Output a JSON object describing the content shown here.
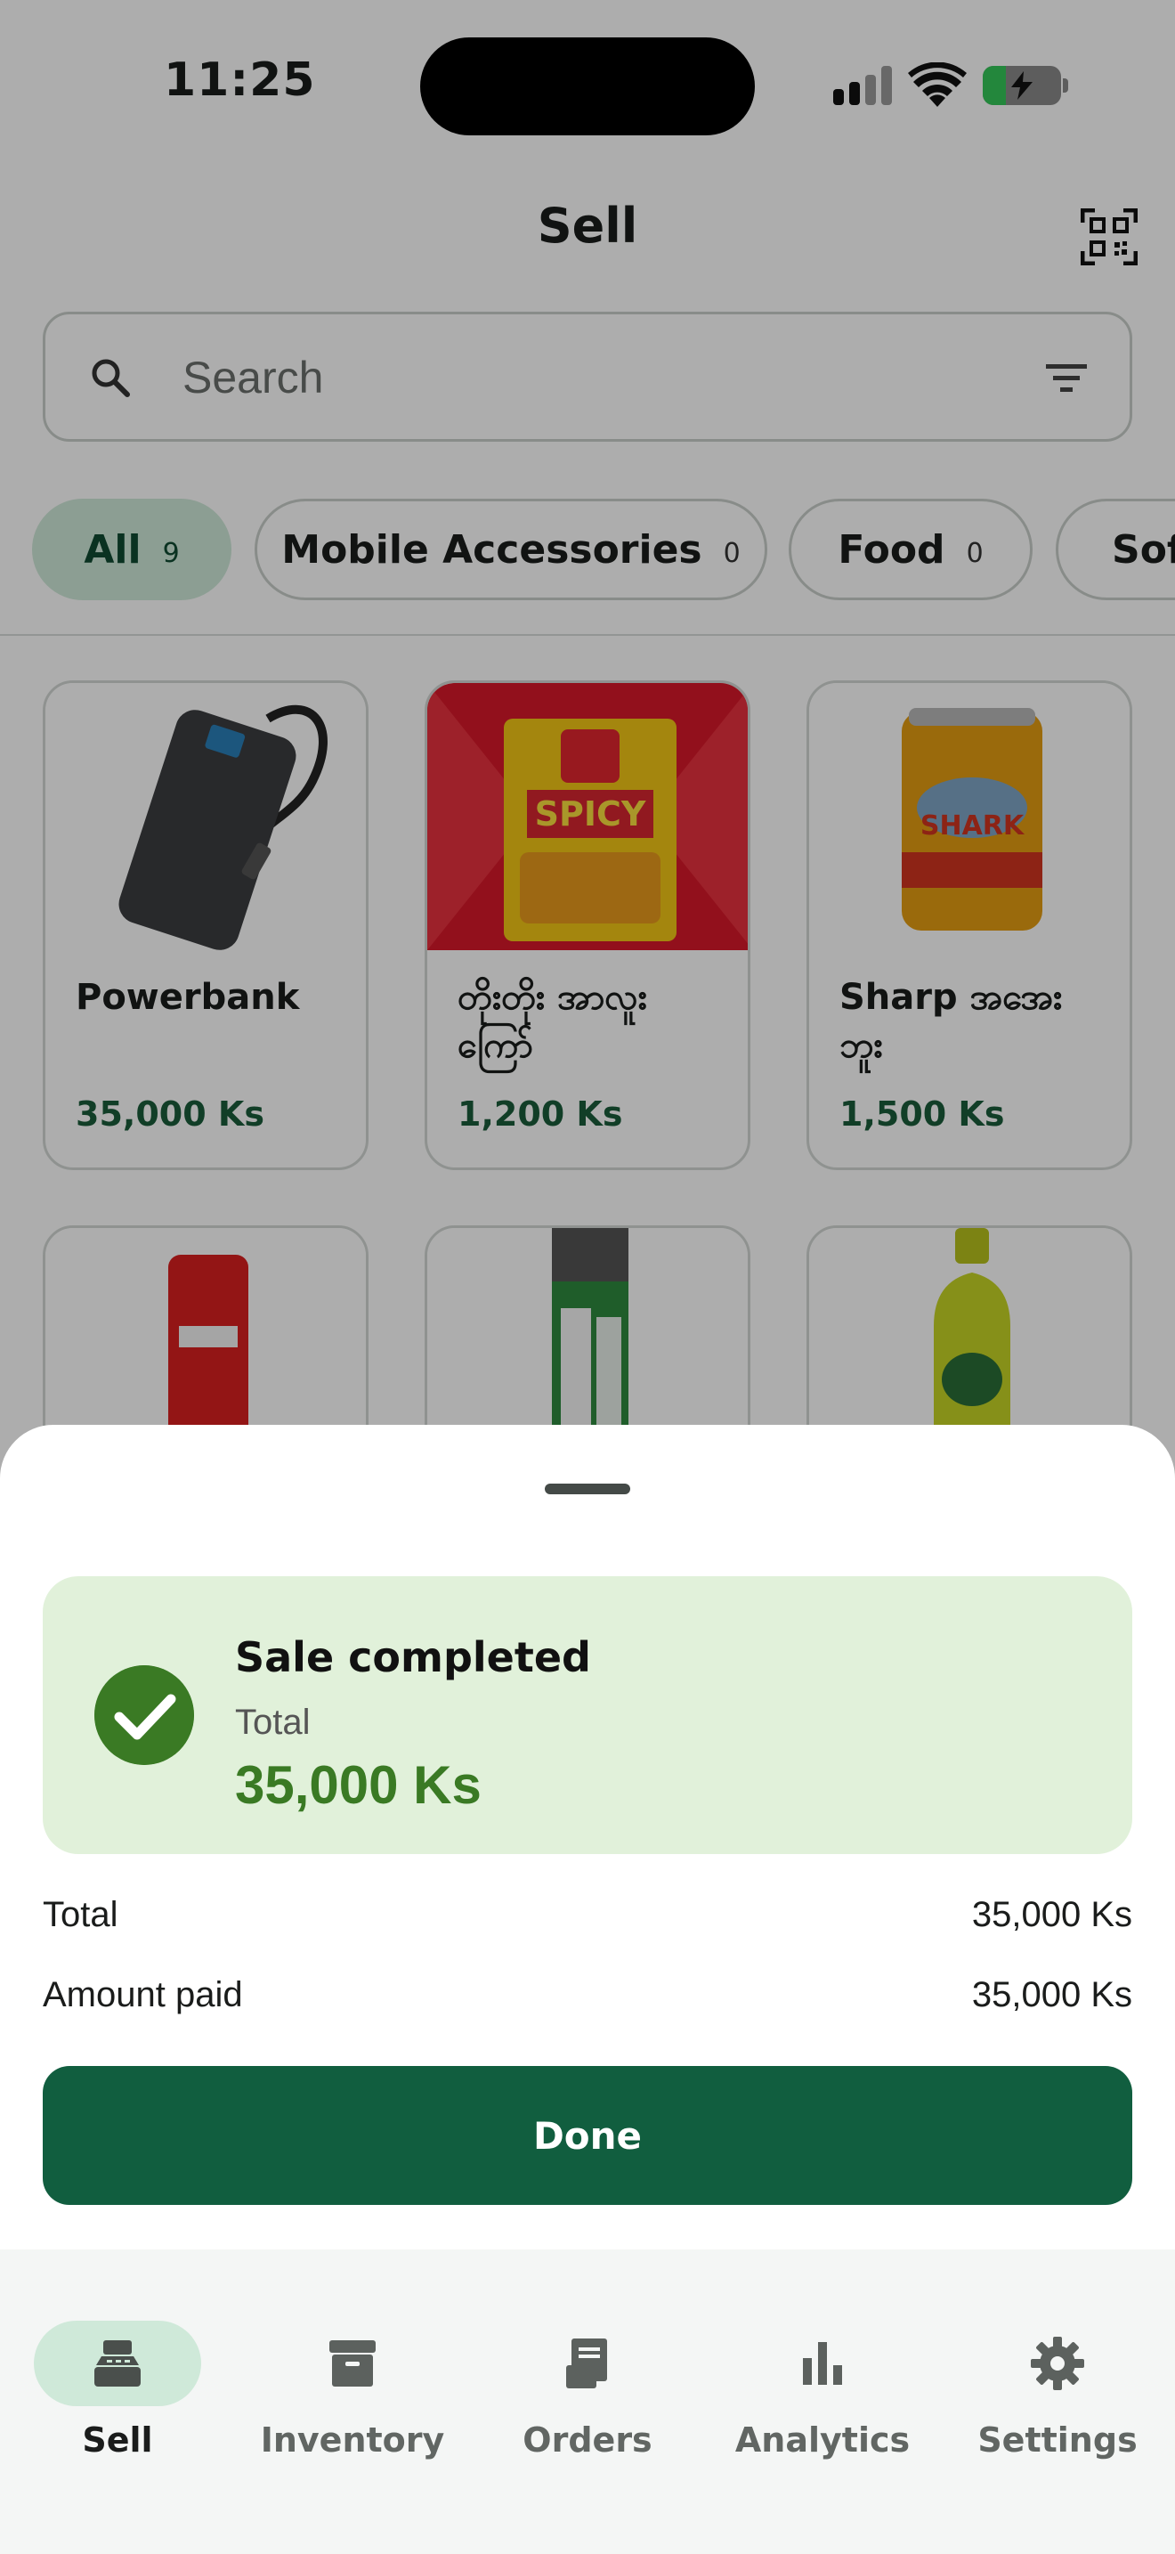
{
  "status_bar": {
    "time": "11:25"
  },
  "header": {
    "title": "Sell",
    "qr_icon": "qr-scan-icon"
  },
  "search": {
    "placeholder": "Search"
  },
  "categories": [
    {
      "label": "All",
      "count": "9",
      "active": true
    },
    {
      "label": "Mobile Accessories",
      "count": "0",
      "active": false
    },
    {
      "label": "Food",
      "count": "0",
      "active": false
    },
    {
      "label": "Soft",
      "count": "",
      "active": false
    }
  ],
  "products": [
    {
      "name": "Powerbank",
      "price": "35,000 Ks"
    },
    {
      "name": "တိုးတိုး အာလူး ကြော်",
      "price": "1,200 Ks"
    },
    {
      "name": "Sharp အအေး ဘူး",
      "price": "1,500 Ks"
    }
  ],
  "sheet": {
    "title": "Sale completed",
    "total_label": "Total",
    "total_amount": "35,000 Ks",
    "rows": [
      {
        "label": "Total",
        "value": "35,000 Ks"
      },
      {
        "label": "Amount paid",
        "value": "35,000 Ks"
      }
    ],
    "done_label": "Done"
  },
  "nav": {
    "items": [
      {
        "label": "Sell",
        "icon": "cash-register-icon",
        "active": true
      },
      {
        "label": "Inventory",
        "icon": "archive-box-icon",
        "active": false
      },
      {
        "label": "Orders",
        "icon": "receipt-icon",
        "active": false
      },
      {
        "label": "Analytics",
        "icon": "bar-chart-icon",
        "active": false
      },
      {
        "label": "Settings",
        "icon": "gear-icon",
        "active": false
      }
    ]
  },
  "colors": {
    "brand_green": "#115e3f",
    "success_green": "#3a7a24",
    "chip_active_bg": "#cfe9d9",
    "success_bg": "#e1f1da"
  }
}
